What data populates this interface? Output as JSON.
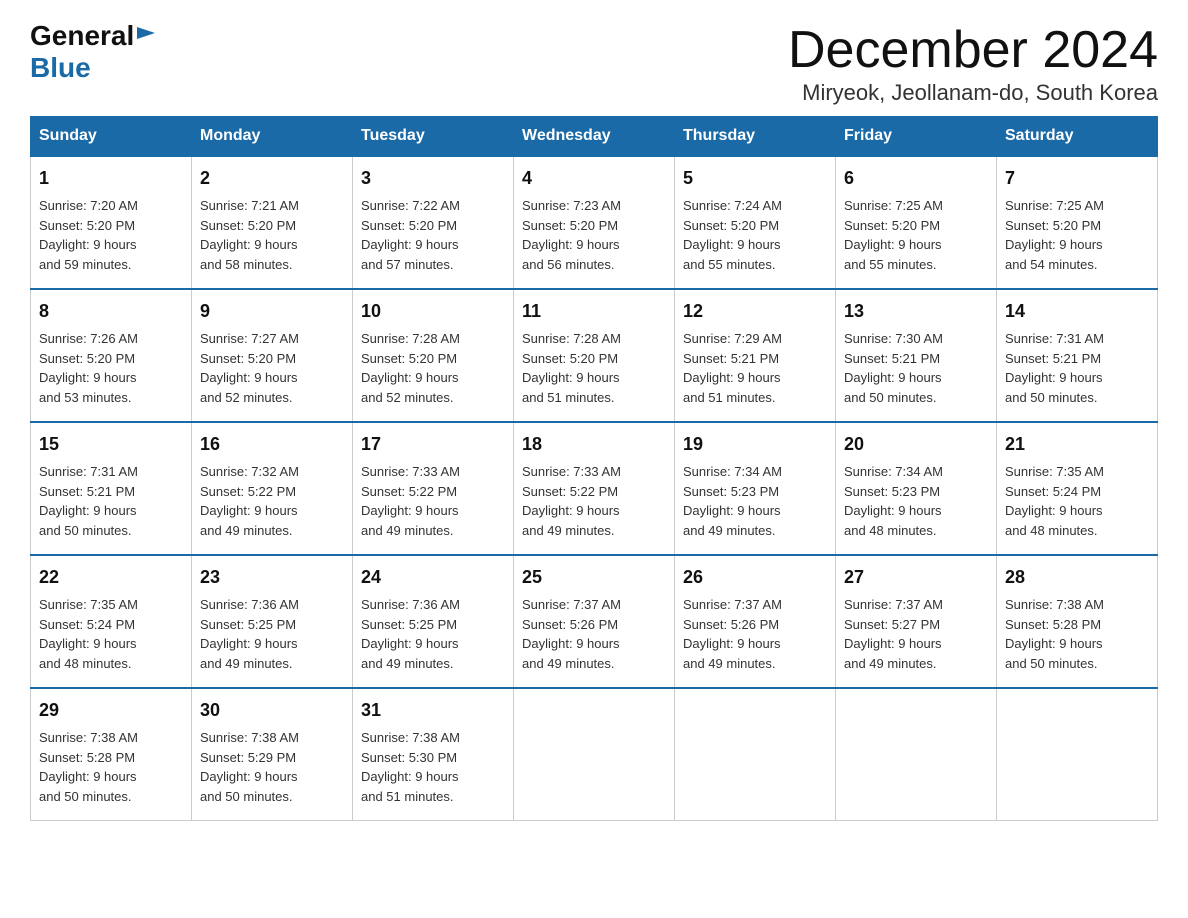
{
  "header": {
    "logo_general": "General",
    "logo_triangle": "▶",
    "logo_blue": "Blue",
    "title": "December 2024",
    "subtitle": "Miryeok, Jeollanam-do, South Korea"
  },
  "days_of_week": [
    "Sunday",
    "Monday",
    "Tuesday",
    "Wednesday",
    "Thursday",
    "Friday",
    "Saturday"
  ],
  "weeks": [
    [
      {
        "day": "1",
        "sunrise": "7:20 AM",
        "sunset": "5:20 PM",
        "daylight": "9 hours and 59 minutes."
      },
      {
        "day": "2",
        "sunrise": "7:21 AM",
        "sunset": "5:20 PM",
        "daylight": "9 hours and 58 minutes."
      },
      {
        "day": "3",
        "sunrise": "7:22 AM",
        "sunset": "5:20 PM",
        "daylight": "9 hours and 57 minutes."
      },
      {
        "day": "4",
        "sunrise": "7:23 AM",
        "sunset": "5:20 PM",
        "daylight": "9 hours and 56 minutes."
      },
      {
        "day": "5",
        "sunrise": "7:24 AM",
        "sunset": "5:20 PM",
        "daylight": "9 hours and 55 minutes."
      },
      {
        "day": "6",
        "sunrise": "7:25 AM",
        "sunset": "5:20 PM",
        "daylight": "9 hours and 55 minutes."
      },
      {
        "day": "7",
        "sunrise": "7:25 AM",
        "sunset": "5:20 PM",
        "daylight": "9 hours and 54 minutes."
      }
    ],
    [
      {
        "day": "8",
        "sunrise": "7:26 AM",
        "sunset": "5:20 PM",
        "daylight": "9 hours and 53 minutes."
      },
      {
        "day": "9",
        "sunrise": "7:27 AM",
        "sunset": "5:20 PM",
        "daylight": "9 hours and 52 minutes."
      },
      {
        "day": "10",
        "sunrise": "7:28 AM",
        "sunset": "5:20 PM",
        "daylight": "9 hours and 52 minutes."
      },
      {
        "day": "11",
        "sunrise": "7:28 AM",
        "sunset": "5:20 PM",
        "daylight": "9 hours and 51 minutes."
      },
      {
        "day": "12",
        "sunrise": "7:29 AM",
        "sunset": "5:21 PM",
        "daylight": "9 hours and 51 minutes."
      },
      {
        "day": "13",
        "sunrise": "7:30 AM",
        "sunset": "5:21 PM",
        "daylight": "9 hours and 50 minutes."
      },
      {
        "day": "14",
        "sunrise": "7:31 AM",
        "sunset": "5:21 PM",
        "daylight": "9 hours and 50 minutes."
      }
    ],
    [
      {
        "day": "15",
        "sunrise": "7:31 AM",
        "sunset": "5:21 PM",
        "daylight": "9 hours and 50 minutes."
      },
      {
        "day": "16",
        "sunrise": "7:32 AM",
        "sunset": "5:22 PM",
        "daylight": "9 hours and 49 minutes."
      },
      {
        "day": "17",
        "sunrise": "7:33 AM",
        "sunset": "5:22 PM",
        "daylight": "9 hours and 49 minutes."
      },
      {
        "day": "18",
        "sunrise": "7:33 AM",
        "sunset": "5:22 PM",
        "daylight": "9 hours and 49 minutes."
      },
      {
        "day": "19",
        "sunrise": "7:34 AM",
        "sunset": "5:23 PM",
        "daylight": "9 hours and 49 minutes."
      },
      {
        "day": "20",
        "sunrise": "7:34 AM",
        "sunset": "5:23 PM",
        "daylight": "9 hours and 48 minutes."
      },
      {
        "day": "21",
        "sunrise": "7:35 AM",
        "sunset": "5:24 PM",
        "daylight": "9 hours and 48 minutes."
      }
    ],
    [
      {
        "day": "22",
        "sunrise": "7:35 AM",
        "sunset": "5:24 PM",
        "daylight": "9 hours and 48 minutes."
      },
      {
        "day": "23",
        "sunrise": "7:36 AM",
        "sunset": "5:25 PM",
        "daylight": "9 hours and 49 minutes."
      },
      {
        "day": "24",
        "sunrise": "7:36 AM",
        "sunset": "5:25 PM",
        "daylight": "9 hours and 49 minutes."
      },
      {
        "day": "25",
        "sunrise": "7:37 AM",
        "sunset": "5:26 PM",
        "daylight": "9 hours and 49 minutes."
      },
      {
        "day": "26",
        "sunrise": "7:37 AM",
        "sunset": "5:26 PM",
        "daylight": "9 hours and 49 minutes."
      },
      {
        "day": "27",
        "sunrise": "7:37 AM",
        "sunset": "5:27 PM",
        "daylight": "9 hours and 49 minutes."
      },
      {
        "day": "28",
        "sunrise": "7:38 AM",
        "sunset": "5:28 PM",
        "daylight": "9 hours and 50 minutes."
      }
    ],
    [
      {
        "day": "29",
        "sunrise": "7:38 AM",
        "sunset": "5:28 PM",
        "daylight": "9 hours and 50 minutes."
      },
      {
        "day": "30",
        "sunrise": "7:38 AM",
        "sunset": "5:29 PM",
        "daylight": "9 hours and 50 minutes."
      },
      {
        "day": "31",
        "sunrise": "7:38 AM",
        "sunset": "5:30 PM",
        "daylight": "9 hours and 51 minutes."
      },
      null,
      null,
      null,
      null
    ]
  ],
  "labels": {
    "sunrise": "Sunrise:",
    "sunset": "Sunset:",
    "daylight": "Daylight:"
  }
}
